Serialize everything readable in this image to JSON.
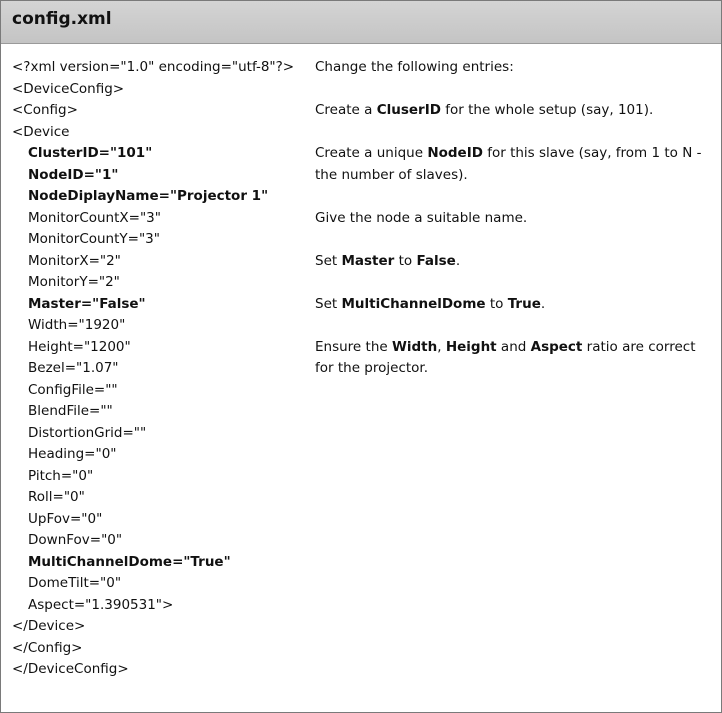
{
  "header": {
    "title": "config.xml"
  },
  "code_lines": [
    {
      "text": "<?xml version=\"1.0\" encoding=\"utf-8\"?>",
      "bold": false,
      "indent": false,
      "wrap": true
    },
    {
      "text": "<DeviceConfig>",
      "bold": false,
      "indent": false
    },
    {
      "text": "<Config>",
      "bold": false,
      "indent": false
    },
    {
      "text": "<Device",
      "bold": false,
      "indent": false
    },
    {
      "text": "ClusterID=\"101\"",
      "bold": true,
      "indent": true
    },
    {
      "text": "NodeID=\"1\"",
      "bold": true,
      "indent": true
    },
    {
      "text": "NodeDiplayName=\"Projector 1\"",
      "bold": true,
      "indent": true
    },
    {
      "text": "MonitorCountX=\"3\"",
      "bold": false,
      "indent": true
    },
    {
      "text": "MonitorCountY=\"3\"",
      "bold": false,
      "indent": true
    },
    {
      "text": "MonitorX=\"2\"",
      "bold": false,
      "indent": true
    },
    {
      "text": "MonitorY=\"2\"",
      "bold": false,
      "indent": true
    },
    {
      "text": "Master=\"False\"",
      "bold": true,
      "indent": true
    },
    {
      "text": "Width=\"1920\"",
      "bold": false,
      "indent": true
    },
    {
      "text": "Height=\"1200\"",
      "bold": false,
      "indent": true
    },
    {
      "text": "Bezel=\"1.07\"",
      "bold": false,
      "indent": true
    },
    {
      "text": "ConfigFile=\"\"",
      "bold": false,
      "indent": true
    },
    {
      "text": "BlendFile=\"\"",
      "bold": false,
      "indent": true
    },
    {
      "text": "DistortionGrid=\"\"",
      "bold": false,
      "indent": true
    },
    {
      "text": "Heading=\"0\"",
      "bold": false,
      "indent": true
    },
    {
      "text": "Pitch=\"0\"",
      "bold": false,
      "indent": true
    },
    {
      "text": "Roll=\"0\"",
      "bold": false,
      "indent": true
    },
    {
      "text": "UpFov=\"0\"",
      "bold": false,
      "indent": true
    },
    {
      "text": "DownFov=\"0\"",
      "bold": false,
      "indent": true
    },
    {
      "text": "MultiChannelDome=\"True\"",
      "bold": true,
      "indent": true
    },
    {
      "text": "DomeTilt=\"0\"",
      "bold": false,
      "indent": true
    },
    {
      "text": "Aspect=\"1.390531\">",
      "bold": false,
      "indent": true
    },
    {
      "text": "</Device>",
      "bold": false,
      "indent": false
    },
    {
      "text": "</Config>",
      "bold": false,
      "indent": false
    },
    {
      "text": "</DeviceConfig>",
      "bold": false,
      "indent": false
    }
  ],
  "notes": [
    {
      "line": 0,
      "parts": [
        {
          "t": "Change the following entries:",
          "b": false
        }
      ]
    },
    {
      "line": 2,
      "parts": [
        {
          "t": "Create a ",
          "b": false
        },
        {
          "t": "CluserID",
          "b": true
        },
        {
          "t": " for the whole setup (say, 101).",
          "b": false
        }
      ]
    },
    {
      "line": 4,
      "parts": [
        {
          "t": "Create a unique ",
          "b": false
        },
        {
          "t": "NodeID",
          "b": true
        },
        {
          "t": " for this slave (say, from 1 to N - the number of slaves).",
          "b": false
        }
      ]
    },
    {
      "line": 7,
      "parts": [
        {
          "t": "Give the node a suitable name.",
          "b": false
        }
      ]
    },
    {
      "line": 9,
      "parts": [
        {
          "t": "Set ",
          "b": false
        },
        {
          "t": "Master",
          "b": true
        },
        {
          "t": " to ",
          "b": false
        },
        {
          "t": "False",
          "b": true
        },
        {
          "t": ".",
          "b": false
        }
      ]
    },
    {
      "line": 11,
      "parts": [
        {
          "t": "Set ",
          "b": false
        },
        {
          "t": "MultiChannelDome",
          "b": true
        },
        {
          "t": " to ",
          "b": false
        },
        {
          "t": "True",
          "b": true
        },
        {
          "t": ".",
          "b": false
        }
      ]
    },
    {
      "line": 13,
      "parts": [
        {
          "t": "Ensure the ",
          "b": false
        },
        {
          "t": "Width",
          "b": true
        },
        {
          "t": ", ",
          "b": false
        },
        {
          "t": "Height",
          "b": true
        },
        {
          "t": " and ",
          "b": false
        },
        {
          "t": "Aspect",
          "b": true
        },
        {
          "t": " ratio are correct for the projector.",
          "b": false
        }
      ]
    }
  ]
}
